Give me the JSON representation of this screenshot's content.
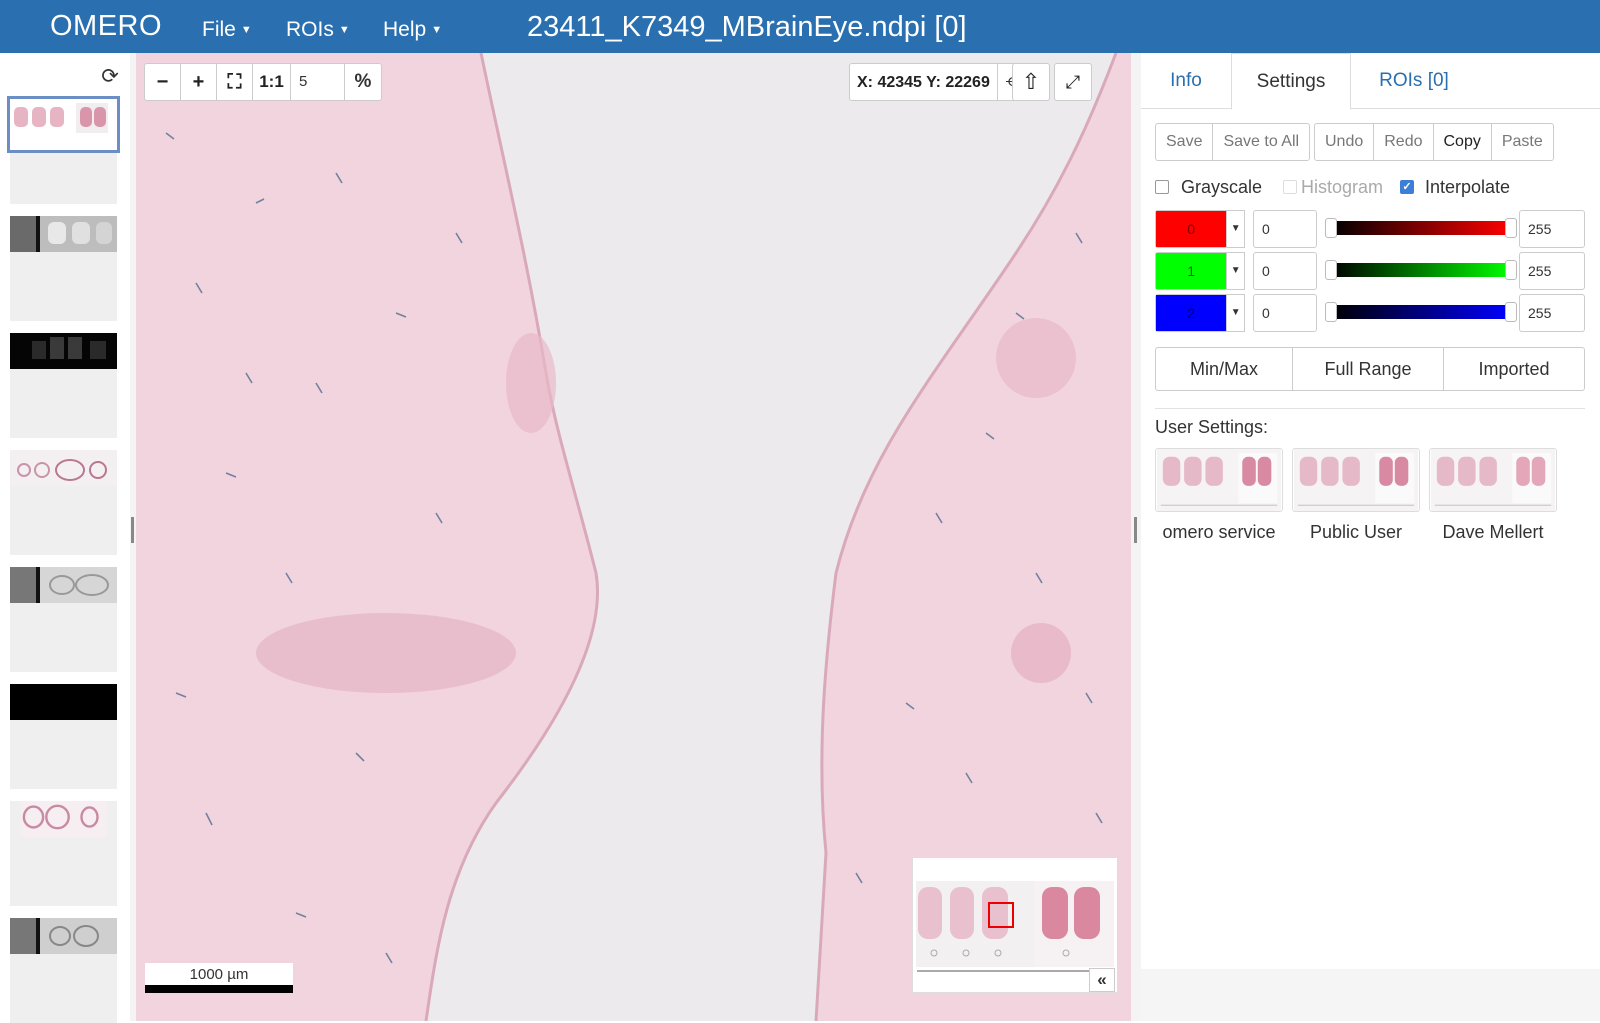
{
  "navbar": {
    "brand": "OMERO",
    "menus": [
      {
        "label": "File"
      },
      {
        "label": "ROIs"
      },
      {
        "label": "Help"
      }
    ],
    "image_title": "23411_K7349_MBrainEye.ndpi [0]",
    "background_color": "#2a6faf"
  },
  "thumbnails": {
    "refresh_icon": "refresh-icon",
    "selected_index": 0,
    "count": 8
  },
  "viewer": {
    "zoom_out_icon": "minus-icon",
    "zoom_in_icon": "plus-icon",
    "fit_icon": "fullscreen-icon",
    "one_to_one_label": "1:1",
    "zoom_value": "5",
    "zoom_unit": "%",
    "coordinates": "X: 42345 Y: 22269",
    "crosshair_icon": "crosshair-icon",
    "upload_icon": "arrow-up-icon",
    "expand_icon": "expand-icon",
    "scalebar_label": "1000 µm",
    "overview_toggle": "«",
    "tissue_color": "#f1d4dd"
  },
  "right_panel": {
    "tabs": [
      {
        "label": "Info",
        "active": false
      },
      {
        "label": "Settings",
        "active": true
      },
      {
        "label": "ROIs [0]",
        "active": false
      }
    ],
    "group1": [
      "Save",
      "Save to All"
    ],
    "group2": [
      "Undo",
      "Redo",
      "Copy",
      "Paste"
    ],
    "checkboxes": [
      {
        "label": "Grayscale",
        "checked": false
      },
      {
        "label": "Histogram",
        "checked": false
      },
      {
        "label": "Interpolate",
        "checked": true
      }
    ],
    "channels": [
      {
        "label": "0",
        "color": "#ff0000",
        "min": "0",
        "max": "255"
      },
      {
        "label": "1",
        "color": "#00ff00",
        "min": "0",
        "max": "255"
      },
      {
        "label": "2",
        "color": "#0000ff",
        "min": "0",
        "max": "255"
      }
    ],
    "range_buttons": [
      "Min/Max",
      "Full Range",
      "Imported"
    ],
    "user_settings_title": "User Settings:",
    "users": [
      "omero service",
      "Public User",
      "Dave Mellert"
    ]
  }
}
